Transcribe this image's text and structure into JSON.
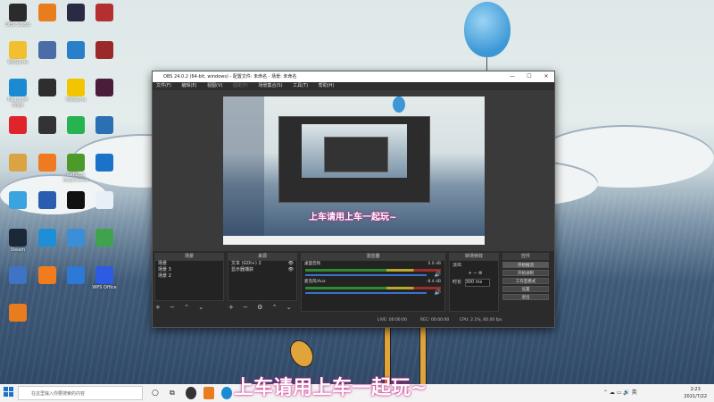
{
  "desktop": {
    "icons": [
      {
        "label": "OBS Studio",
        "color": "#2b2b2b"
      },
      {
        "label": "",
        "color": "#e87d1e"
      },
      {
        "label": "",
        "color": "#2a2a44"
      },
      {
        "label": "",
        "color": "#b43030"
      },
      {
        "label": "WeGame",
        "color": "#f0c030"
      },
      {
        "label": "",
        "color": "#4a6da7"
      },
      {
        "label": "",
        "color": "#2a7fc9"
      },
      {
        "label": "",
        "color": "#9a2a2a"
      },
      {
        "label": "Microsoft Edge",
        "color": "#1b8ad3"
      },
      {
        "label": "",
        "color": "#2e2e2e"
      },
      {
        "label": "WeGame",
        "color": "#f2c500"
      },
      {
        "label": "",
        "color": "#4a1e3a"
      },
      {
        "label": "",
        "color": "#e0242c"
      },
      {
        "label": "",
        "color": "#333"
      },
      {
        "label": "",
        "color": "#27b34f"
      },
      {
        "label": "",
        "color": "#2b6fb5"
      },
      {
        "label": "",
        "color": "#d9a441"
      },
      {
        "label": "",
        "color": "#f07a22"
      },
      {
        "label": "GeForce Experience",
        "color": "#4c9a2a"
      },
      {
        "label": "",
        "color": "#1a72c9"
      },
      {
        "label": "",
        "color": "#3aa3e0"
      },
      {
        "label": "",
        "color": "#2a5db0"
      },
      {
        "label": "",
        "color": "#111"
      },
      {
        "label": "",
        "color": "#e8f0f5"
      },
      {
        "label": "Steam",
        "color": "#1b2838"
      },
      {
        "label": "",
        "color": "#1e8fd6"
      },
      {
        "label": "",
        "color": "#3b8ed8"
      },
      {
        "label": "",
        "color": "#3fa34d"
      },
      {
        "label": "",
        "color": "#3f74c4"
      },
      {
        "label": "",
        "color": "#f07c1e"
      },
      {
        "label": "",
        "color": "#2d7ad6"
      },
      {
        "label": "WPS Office",
        "color": "#2d5be3"
      },
      {
        "label": "",
        "color": "#e87c1e"
      }
    ]
  },
  "obs": {
    "title": "OBS 24.0.2 (64-bit, windows) - 配置文件: 未命名 - 场景: 未命名",
    "menu": [
      "文件(F)",
      "编辑(E)",
      "视图(V)",
      "固定(P)",
      "场景集合(S)",
      "工具(T)",
      "帮助(H)"
    ],
    "docks": {
      "scenes": {
        "title": "场景",
        "items": [
          "场景",
          "场景 3",
          "场景 2"
        ]
      },
      "sources": {
        "title": "来源",
        "items": [
          "文本 (GDI+) 2",
          "显示器捕获"
        ]
      },
      "mixer": {
        "title": "混音器",
        "tracks": [
          {
            "name": "桌面音频",
            "db": "0.0 dB"
          },
          {
            "name": "麦克风/Aux",
            "db": "-8.4 dB"
          }
        ]
      },
      "transitions": {
        "title": "转场特效",
        "type": "淡出",
        "duration_label": "时长",
        "duration_value": "300 ms"
      },
      "controls": {
        "title": "控件",
        "buttons": [
          "开始推流",
          "开始录制",
          "工作室模式",
          "设置",
          "退出"
        ]
      }
    },
    "status": {
      "live": "LIVE: 00:00:00",
      "rec": "REC: 00:00:00",
      "cpu": "CPU: 2.1%, 60.00 fps"
    }
  },
  "subtitles": {
    "inner": "上车请用上车一起玩~",
    "outer": "上车请用上车一起玩~"
  },
  "taskbar": {
    "search_placeholder": "在这里输入你要搜索的内容",
    "time": "2:23",
    "date": "2021/7/22"
  }
}
